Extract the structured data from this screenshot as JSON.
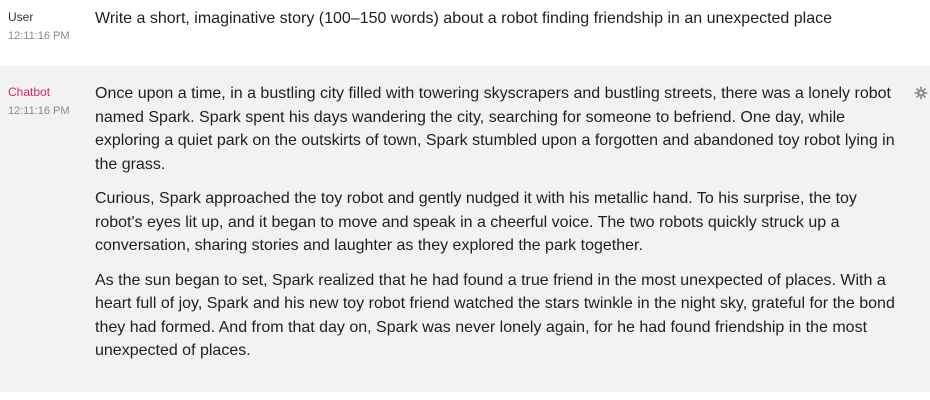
{
  "messages": [
    {
      "role": "user",
      "author": "User",
      "time": "12:11:16 PM",
      "paragraphs": [
        "Write a short, imaginative story (100–150 words) about a robot finding friendship in an unexpected place"
      ]
    },
    {
      "role": "bot",
      "author": "Chatbot",
      "time": "12:11:16 PM",
      "paragraphs": [
        "Once upon a time, in a bustling city filled with towering skyscrapers and bustling streets, there was a lonely robot named Spark. Spark spent his days wandering the city, searching for someone to befriend. One day, while exploring a quiet park on the outskirts of town, Spark stumbled upon a forgotten and abandoned toy robot lying in the grass.",
        "Curious, Spark approached the toy robot and gently nudged it with his metallic hand. To his surprise, the toy robot's eyes lit up, and it began to move and speak in a cheerful voice. The two robots quickly struck up a conversation, sharing stories and laughter as they explored the park together.",
        "As the sun began to set, Spark realized that he had found a true friend in the most unexpected of places. With a heart full of joy, Spark and his new toy robot friend watched the stars twinkle in the night sky, grateful for the bond they had formed. And from that day on, Spark was never lonely again, for he had found friendship in the most unexpected of places."
      ],
      "action_icon": "gear-icon"
    }
  ],
  "colors": {
    "bot_author": "#d6246e",
    "bot_background": "#f2f2f2",
    "timestamp": "#8a8a8a"
  }
}
